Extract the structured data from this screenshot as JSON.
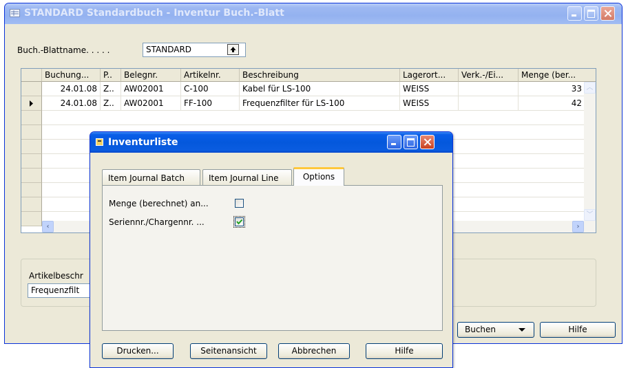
{
  "main_window": {
    "title": "STANDARD Standardbuch - Inventur Buch.-Blatt",
    "batch_label": "Buch.-Blattname. . . . .",
    "batch_value": "STANDARD",
    "columns": [
      "Buchung...",
      "P..",
      "Belegnr.",
      "Artikelnr.",
      "Beschreibung",
      "Lagerort...",
      "Verk.-/Ei...",
      "Menge (ber..."
    ],
    "rows": [
      {
        "date": "24.01.08",
        "p": "Z..",
        "doc": "AW02001",
        "item": "C-100",
        "desc": "Kabel für LS-100",
        "location": "WEISS",
        "verk": "",
        "qty": "33"
      },
      {
        "date": "24.01.08",
        "p": "Z..",
        "doc": "AW02001",
        "item": "FF-100",
        "desc": "Frequenzfilter für LS-100",
        "location": "WEISS",
        "verk": "",
        "qty": "42"
      }
    ],
    "item_desc_label": "Artikelbeschr",
    "item_desc_value": "Frequenzfilt",
    "post_button": "Buchen",
    "help_button": "Hilfe"
  },
  "dialog": {
    "title": "Inventurliste",
    "tabs": [
      "Item Journal Batch",
      "Item Journal Line",
      "Options"
    ],
    "active_tab": 2,
    "options": [
      {
        "label": "Menge (berechnet) an...",
        "checked": false
      },
      {
        "label": "Seriennr./Chargennr. ...",
        "checked": true
      }
    ],
    "buttons": {
      "print": "Drucken...",
      "preview": "Seitenansicht",
      "cancel": "Abbrechen",
      "help": "Hilfe"
    }
  },
  "colors": {
    "titlebar": "#0458dc",
    "window_face": "#ece9d8",
    "active_tab_accent": "#ffc83c",
    "check": "#21a121"
  }
}
